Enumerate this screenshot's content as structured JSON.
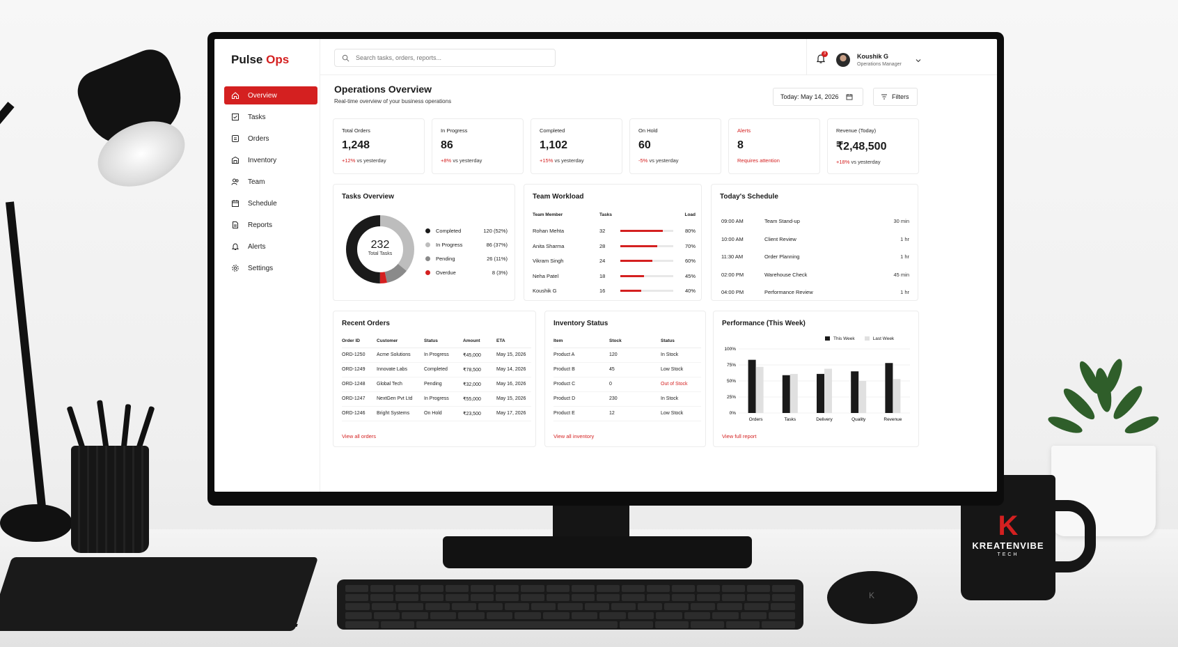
{
  "brand": {
    "name": "Pulse",
    "accent": "Ops",
    "accent_color": "#d42020"
  },
  "nav": [
    {
      "label": "Overview",
      "icon": "home-icon"
    },
    {
      "label": "Tasks",
      "icon": "tasks-icon"
    },
    {
      "label": "Orders",
      "icon": "orders-icon"
    },
    {
      "label": "Inventory",
      "icon": "inventory-icon"
    },
    {
      "label": "Team",
      "icon": "team-icon"
    },
    {
      "label": "Schedule",
      "icon": "calendar-icon"
    },
    {
      "label": "Reports",
      "icon": "reports-icon"
    },
    {
      "label": "Alerts",
      "icon": "bell-icon"
    },
    {
      "label": "Settings",
      "icon": "gear-icon"
    }
  ],
  "search": {
    "placeholder": "Search tasks, orders, reports..."
  },
  "notifications": {
    "count": "3"
  },
  "user": {
    "name": "Koushik G",
    "role": "Operations Manager"
  },
  "page": {
    "title": "Operations Overview",
    "subtitle": "Real-time overview of your business operations",
    "date": "Today: May 14, 2026",
    "filters": "Filters"
  },
  "kpis": [
    {
      "label": "Total Orders",
      "value": "1,248",
      "delta": "+12%",
      "delta_text": "vs yesterday"
    },
    {
      "label": "In Progress",
      "value": "86",
      "delta": "+8%",
      "delta_text": "vs yesterday"
    },
    {
      "label": "Completed",
      "value": "1,102",
      "delta": "+15%",
      "delta_text": "vs yesterday"
    },
    {
      "label": "On Hold",
      "value": "60",
      "delta": "-5%",
      "delta_text": "vs yesterday"
    },
    {
      "label": "Alerts",
      "value": "8",
      "delta": "",
      "delta_text": "Requires attention"
    },
    {
      "label": "Revenue (Today)",
      "value": "₹2,48,500",
      "delta": "+18%",
      "delta_text": "vs yesterday"
    }
  ],
  "tasks_overview": {
    "title": "Tasks Overview",
    "total": "232",
    "total_label": "Total Tasks",
    "items": [
      {
        "name": "Completed",
        "value": "120 (52%)",
        "count": 120,
        "color": "#1a1a1a"
      },
      {
        "name": "In Progress",
        "value": "86 (37%)",
        "count": 86,
        "color": "#bdbdbd"
      },
      {
        "name": "Pending",
        "value": "26 (11%)",
        "count": 26,
        "color": "#8a8a8a"
      },
      {
        "name": "Overdue",
        "value": "8 (3%)",
        "count": 8,
        "color": "#d42020"
      }
    ]
  },
  "team_workload": {
    "title": "Team Workload",
    "headers": [
      "Team Member",
      "Tasks",
      "Load"
    ],
    "rows": [
      {
        "name": "Rohan Mehta",
        "tasks": "32",
        "load": "80%",
        "pct": 0.8
      },
      {
        "name": "Anita Sharma",
        "tasks": "28",
        "load": "70%",
        "pct": 0.7
      },
      {
        "name": "Vikram Singh",
        "tasks": "24",
        "load": "60%",
        "pct": 0.6
      },
      {
        "name": "Neha Patel",
        "tasks": "18",
        "load": "45%",
        "pct": 0.45
      },
      {
        "name": "Koushik G",
        "tasks": "16",
        "load": "40%",
        "pct": 0.4
      }
    ]
  },
  "schedule": {
    "title": "Today's Schedule",
    "items": [
      {
        "time": "09:00 AM",
        "title": "Team Stand-up",
        "duration": "30 min"
      },
      {
        "time": "10:00 AM",
        "title": "Client Review",
        "duration": "1 hr"
      },
      {
        "time": "11:30 AM",
        "title": "Order Planning",
        "duration": "1 hr"
      },
      {
        "time": "02:00 PM",
        "title": "Warehouse Check",
        "duration": "45 min"
      },
      {
        "time": "04:00 PM",
        "title": "Performance Review",
        "duration": "1 hr"
      }
    ]
  },
  "recent_orders": {
    "title": "Recent Orders",
    "headers": [
      "Order ID",
      "Customer",
      "Status",
      "Amount",
      "ETA"
    ],
    "rows": [
      [
        "ORD-1250",
        "Acme Solutions",
        "In Progress",
        "₹45,000",
        "May 15, 2026"
      ],
      [
        "ORD-1249",
        "Innovate Labs",
        "Completed",
        "₹78,500",
        "May 14, 2026"
      ],
      [
        "ORD-1248",
        "Global Tech",
        "Pending",
        "₹32,000",
        "May 16, 2026"
      ],
      [
        "ORD-1247",
        "NextGen Pvt Ltd",
        "In Progress",
        "₹55,000",
        "May 15, 2026"
      ],
      [
        "ORD-1246",
        "Bright Systems",
        "On Hold",
        "₹23,500",
        "May 17, 2026"
      ]
    ],
    "link": "View all orders"
  },
  "inventory": {
    "title": "Inventory Status",
    "headers": [
      "Item",
      "Stock",
      "Status"
    ],
    "rows": [
      [
        "Product A",
        "120",
        "In Stock"
      ],
      [
        "Product B",
        "45",
        "Low Stock"
      ],
      [
        "Product C",
        "0",
        "Out of Stock"
      ],
      [
        "Product D",
        "230",
        "In Stock"
      ],
      [
        "Product E",
        "12",
        "Low Stock"
      ]
    ],
    "link": "View all inventory"
  },
  "performance": {
    "title": "Performance (This Week)",
    "link": "View full report"
  },
  "chart_data": {
    "type": "bar",
    "categories": [
      "Orders",
      "Tasks",
      "Delivery",
      "Quality",
      "Revenue"
    ],
    "series": [
      {
        "name": "This Week",
        "values": [
          83,
          59,
          61,
          65,
          78
        ],
        "color": "#1a1a1a"
      },
      {
        "name": "Last Week",
        "values": [
          72,
          61,
          69,
          50,
          53
        ],
        "color": "#e0e0e0"
      }
    ],
    "yticks": [
      "0%",
      "25%",
      "50%",
      "75%",
      "100%"
    ],
    "ylim": [
      0,
      100
    ],
    "grid": true,
    "legend": "top-right"
  },
  "mug": {
    "letter": "K",
    "brand": "KREATENVIBE",
    "sub": "TECH"
  }
}
